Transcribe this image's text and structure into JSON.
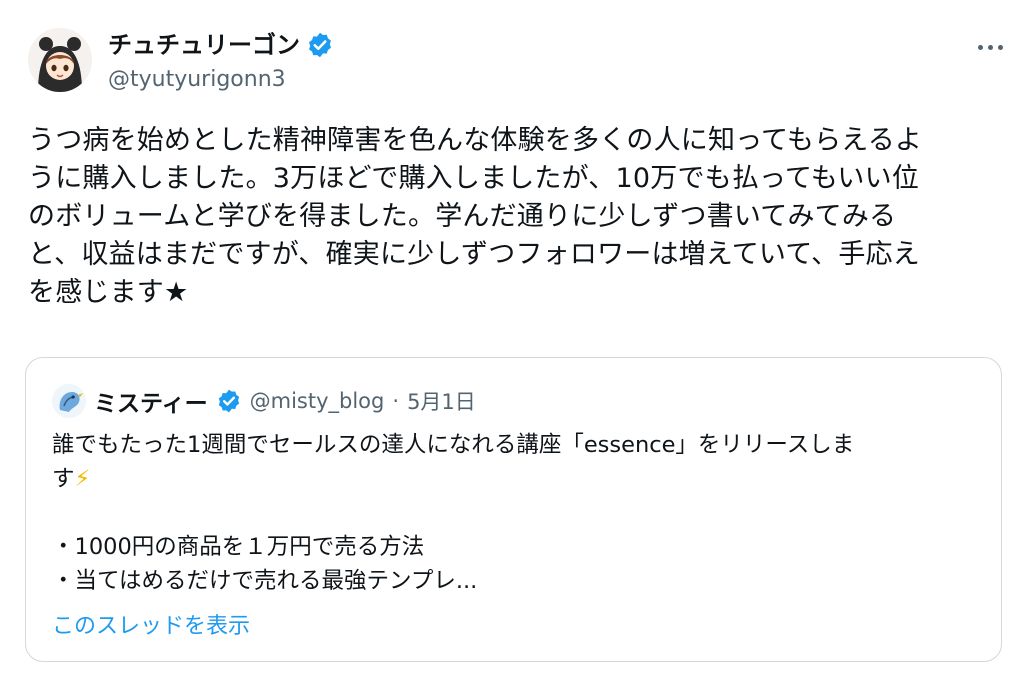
{
  "author": {
    "display_name": "チュチュリーゴン",
    "handle": "@tyutyurigonn3",
    "verified": true
  },
  "more_icon": "more-horizontal-icon",
  "tweet": {
    "text": "うつ病を始めとした精神障害を色んな体験を多くの人に知ってもらえるよ\nうに購入しました。3万ほどで購入しましたが、10万でも払ってもいい位\nのボリュームと学びを得ました。学んだ通りに少しずつ書いてみてみる\nと、収益はまだですが、確実に少しずつフォロワーは増えていて、手応え\nを感じます★"
  },
  "quote": {
    "display_name": "ミスティー",
    "handle": "@misty_blog",
    "separator": "·",
    "date": "5月1日",
    "verified": true,
    "text_line1": "誰でもたった1週間でセールスの達人になれる講座「essence」をリリースしま\nす",
    "emoji": "⚡",
    "text_rest": "\n\n・1000円の商品を１万円で売る方法\n・当てはめるだけで売れる最強テンプレ...",
    "show_thread_label": "このスレッドを表示"
  },
  "colors": {
    "text": "#0f1419",
    "secondary": "#536471",
    "link": "#1d9bf0",
    "verified": "#1d9bf0",
    "border": "#cfd9de"
  }
}
